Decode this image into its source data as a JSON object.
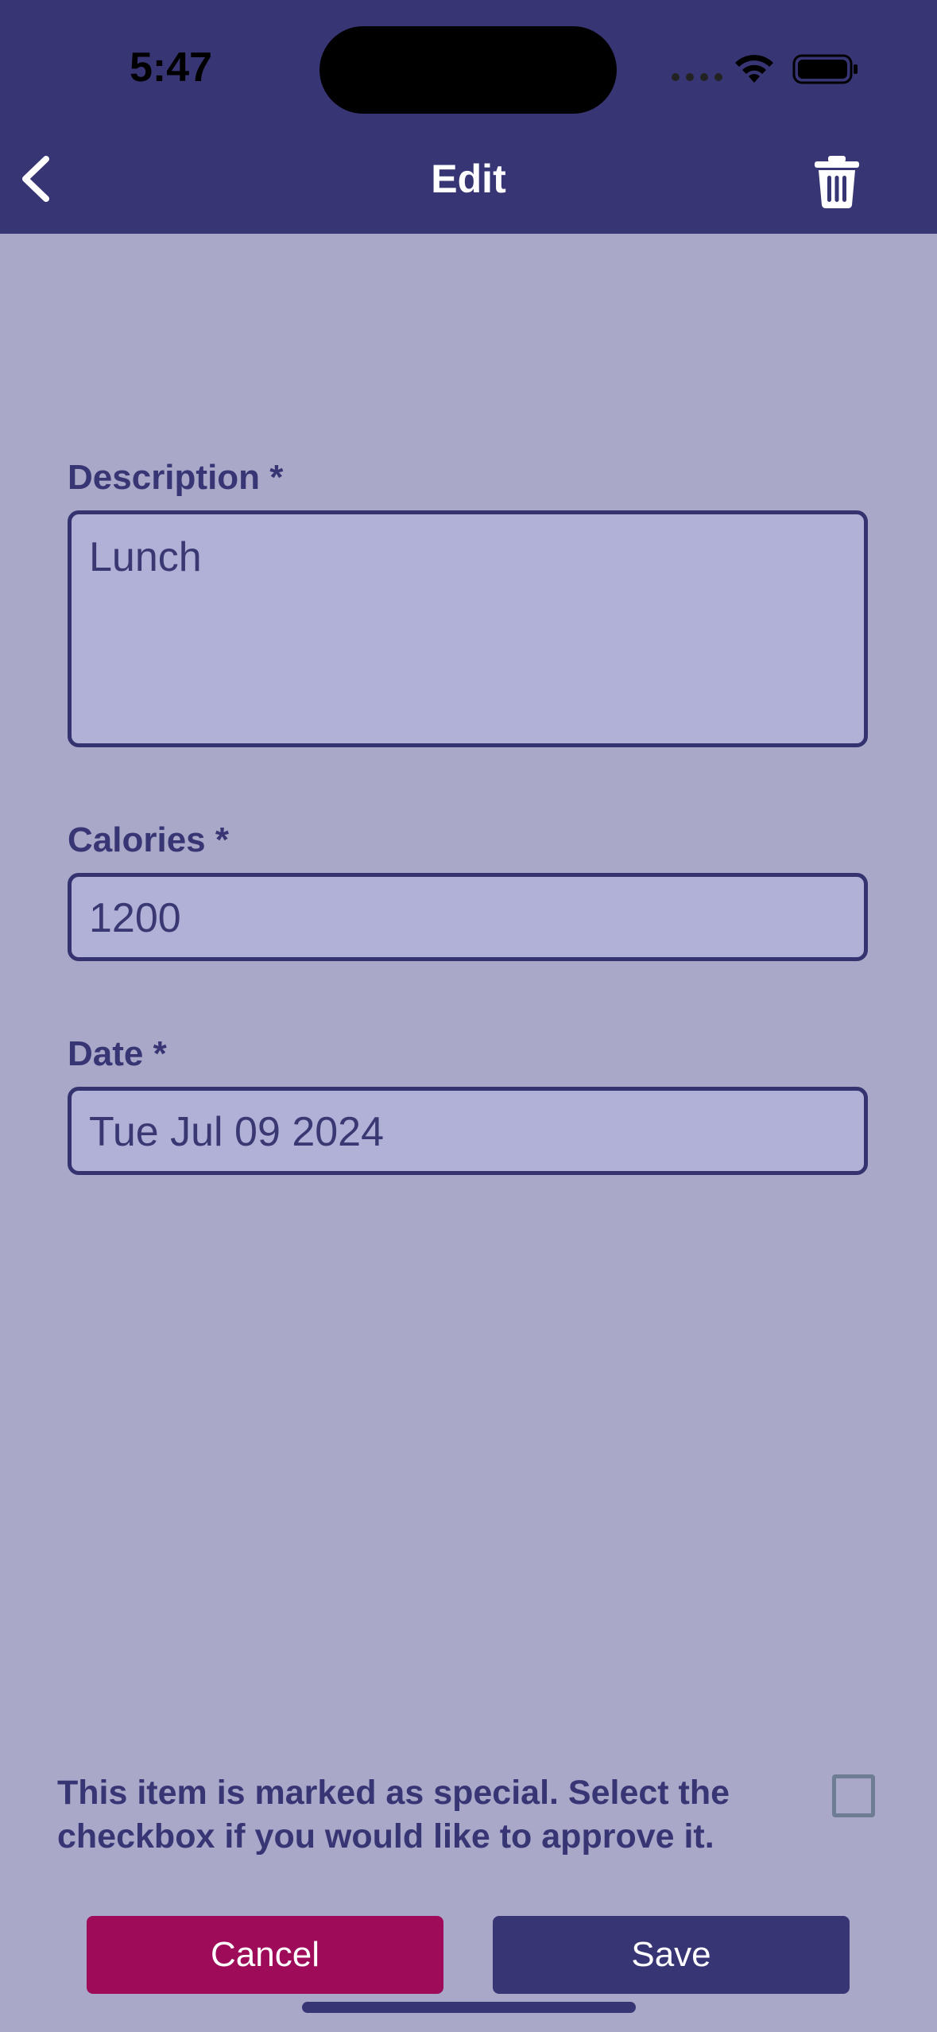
{
  "status_bar": {
    "time": "5:47"
  },
  "nav": {
    "title": "Edit",
    "back_icon": "chevron-left-icon",
    "delete_icon": "trash-icon"
  },
  "form": {
    "description": {
      "label": "Description *",
      "value": "Lunch"
    },
    "calories": {
      "label": "Calories *",
      "value": "1200"
    },
    "date": {
      "label": "Date *",
      "value": "Tue Jul 09 2024"
    }
  },
  "special": {
    "message": "This item is marked as special. Select the checkbox if you would like to approve it.",
    "checked": false
  },
  "actions": {
    "cancel_label": "Cancel",
    "save_label": "Save"
  },
  "colors": {
    "primary": "#383575",
    "background": "#a9a8c8",
    "field_bg": "#b1b0d6",
    "cancel": "#9e0c59"
  }
}
